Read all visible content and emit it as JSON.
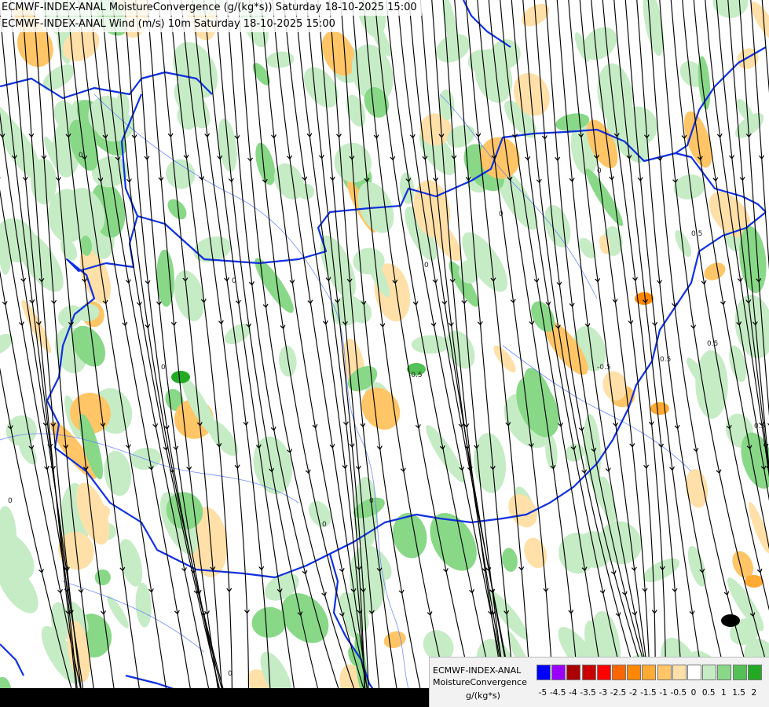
{
  "titles": {
    "line1": "ECMWF-INDEX-ANAL MoistureConvergence (g/(kg*s)) Saturday 18-10-2025 15:00",
    "line2": "ECMWF-INDEX-ANAL Wind (m/s) 10m Saturday 18-10-2025 15:00"
  },
  "legend": {
    "name": "ECMWF-INDEX-ANAL",
    "parameter": "MoistureConvergence",
    "unit": "g/(kg*s)",
    "levels": [
      "-5",
      "-4.5",
      "-4",
      "-3.5",
      "-3",
      "-2.5",
      "-2",
      "-1.5",
      "-1",
      "-0.5",
      "0",
      "0.5",
      "1",
      "1.5",
      "2"
    ],
    "colors": [
      "#0000ff",
      "#9900ff",
      "#aa0000",
      "#cc0000",
      "#ff0000",
      "#ff6600",
      "#ff8800",
      "#ffaa33",
      "#ffc566",
      "#ffe0a8",
      "#ffffff",
      "#c6ecc6",
      "#88d888",
      "#55c055",
      "#22aa22"
    ]
  },
  "map_labels": [
    "0",
    "0",
    "0",
    "0",
    "0",
    "0",
    "0",
    "0",
    "0",
    "0",
    "0.5",
    "0.5",
    "-0.5",
    "-0.5",
    "0.5",
    "0.5"
  ],
  "colors": {
    "border": "#1030e0",
    "river": "#5070ff",
    "streamline": "#000000",
    "green_light": "#c6ecc6",
    "green_mid": "#88d888",
    "orange_light": "#ffe0a8",
    "orange_mid": "#ffc566"
  }
}
